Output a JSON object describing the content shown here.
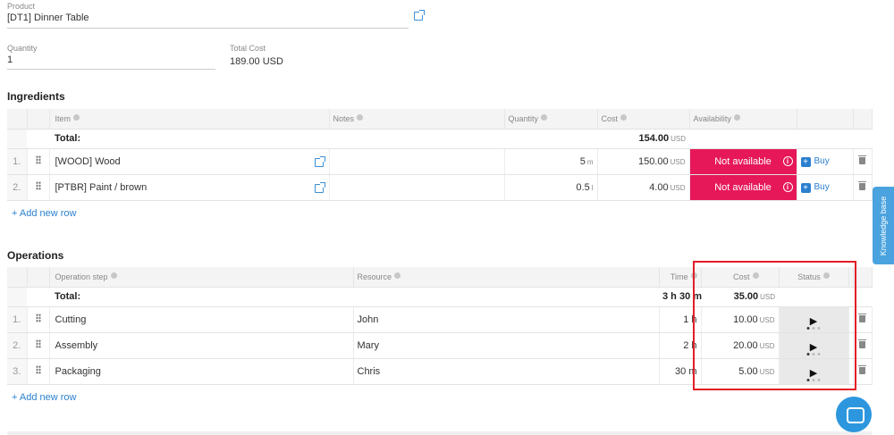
{
  "product": {
    "label": "Product",
    "value": "[DT1] Dinner Table"
  },
  "quantity": {
    "label": "Quantity",
    "value": "1"
  },
  "total_cost": {
    "label": "Total Cost",
    "value": "189.00 USD"
  },
  "ingredients": {
    "title": "Ingredients",
    "headers": {
      "item": "Item",
      "notes": "Notes",
      "quantity": "Quantity",
      "cost": "Cost",
      "availability": "Availability"
    },
    "total_label": "Total:",
    "total_cost": "154.00",
    "total_unit": "USD",
    "rows": [
      {
        "num": "1.",
        "item": "[WOOD] Wood",
        "qty": "5",
        "qty_unit": "m",
        "cost": "150.00",
        "cost_unit": "USD",
        "availability": "Not available",
        "buy": "Buy"
      },
      {
        "num": "2.",
        "item": "[PTBR] Paint / brown",
        "qty": "0.5",
        "qty_unit": "l",
        "cost": "4.00",
        "cost_unit": "USD",
        "availability": "Not available",
        "buy": "Buy"
      }
    ],
    "add_row": "+ Add new row"
  },
  "operations": {
    "title": "Operations",
    "headers": {
      "step": "Operation step",
      "resource": "Resource",
      "time": "Time",
      "cost": "Cost",
      "status": "Status"
    },
    "total_label": "Total:",
    "total_time": "3 h 30 m",
    "total_cost": "35.00",
    "total_unit": "USD",
    "rows": [
      {
        "num": "1.",
        "step": "Cutting",
        "resource": "John",
        "time": "1 h",
        "cost": "10.00",
        "cost_unit": "USD"
      },
      {
        "num": "2.",
        "step": "Assembly",
        "resource": "Mary",
        "time": "2 h",
        "cost": "20.00",
        "cost_unit": "USD"
      },
      {
        "num": "3.",
        "step": "Packaging",
        "resource": "Chris",
        "time": "30 m",
        "cost": "5.00",
        "cost_unit": "USD"
      }
    ],
    "add_row": "+ Add new row"
  },
  "knowledge_base": "Knowledge base",
  "colors": {
    "accent": "#2a7fcf",
    "not_available": "#e6185a",
    "highlight": "#e21e26"
  }
}
